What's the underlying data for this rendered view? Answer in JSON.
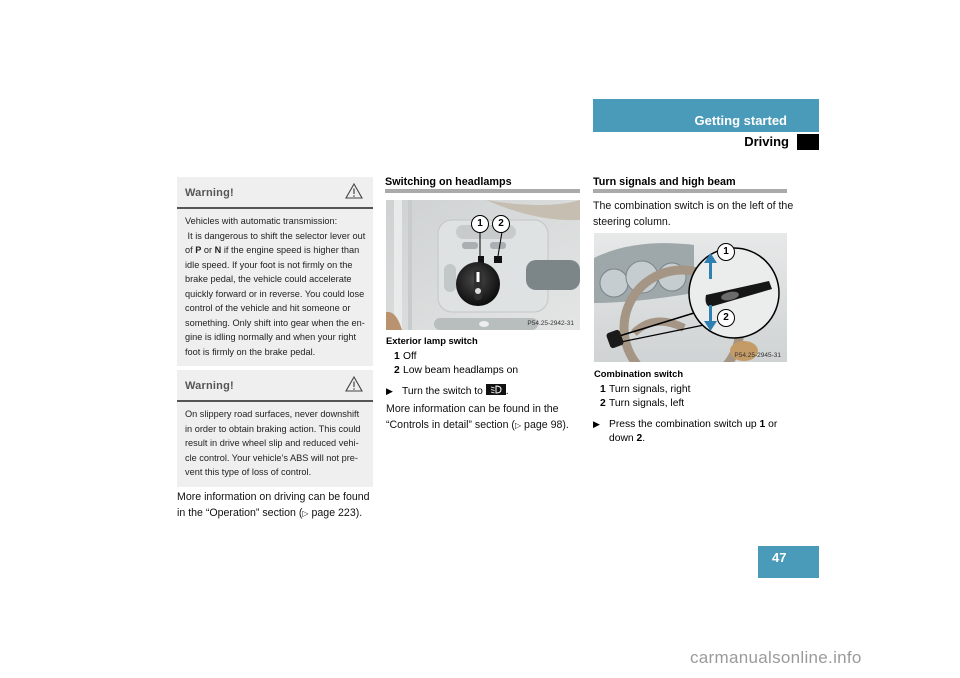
{
  "header": {
    "section": "Getting started",
    "subsection": "Driving"
  },
  "warnings": [
    {
      "title": "Warning!",
      "icon": "warning-triangle-icon",
      "lines": [
        "Vehicles with automatic transmission:",
        " It is dangerous to shift the selector lever out",
        "of P or N if the engine speed is higher than",
        "idle speed. If your foot is not firmly on the",
        "brake pedal, the vehicle could accelerate",
        "quickly forward or in reverse. You could lose",
        "control of the vehicle and hit someone or",
        "something. Only shift into gear when the en-",
        "gine is idling normally and when your right",
        "foot is firmly on the brake pedal."
      ],
      "bold_P": "P",
      "bold_N": "N"
    },
    {
      "title": "Warning!",
      "icon": "warning-triangle-icon",
      "lines": [
        "On slippery road surfaces, never downshift",
        "in order to obtain braking action. This could",
        "result in drive wheel slip and reduced vehi-",
        "cle control. Your vehicle’s ABS will not pre-",
        "vent this type of loss of control."
      ]
    }
  ],
  "left_footer": {
    "line1": "More information on driving can be found",
    "line2_pre": "in the “Operation” section (",
    "ref_icon": "▷",
    "line2_page": " page 223)."
  },
  "headlamps": {
    "title": "Switching on headlamps",
    "figure_code": "P54.25-2942-31",
    "figure_callouts": [
      "1",
      "2"
    ],
    "caption": "Exterior lamp switch",
    "items": [
      {
        "num": "1",
        "text": "Off"
      },
      {
        "num": "2",
        "text": "Low beam headlamps on"
      }
    ],
    "instruction_pre": "Turn the switch to",
    "instruction_icon": "low-beam-icon",
    "instruction_post": ".",
    "more_line1": "More information can be found in the",
    "more_line2_pre": "“Controls in detail” section (",
    "ref_icon": "▷",
    "more_line2_page": " page 98)."
  },
  "turn_signals": {
    "title": "Turn signals and high beam",
    "intro_line1": "The combination switch is on the left of the",
    "intro_line2": "steering column.",
    "figure_code": "P54.25-2945-31",
    "figure_callouts": [
      "1",
      "2"
    ],
    "caption": "Combination switch",
    "items": [
      {
        "num": "1",
        "text": "Turn signals, right"
      },
      {
        "num": "2",
        "text": "Turn signals, left"
      }
    ],
    "instruction_line1_pre": "Press the combination switch up ",
    "instruction_num1": "1",
    "instruction_line1_post": " or",
    "instruction_line2_pre": "down ",
    "instruction_num2": "2",
    "instruction_line2_post": "."
  },
  "page_number": "47",
  "watermark": "carmanualsonline.info",
  "colors": {
    "accent": "#4a9aba",
    "warning_bg": "#efefef",
    "rule": "#aaaaaa"
  }
}
